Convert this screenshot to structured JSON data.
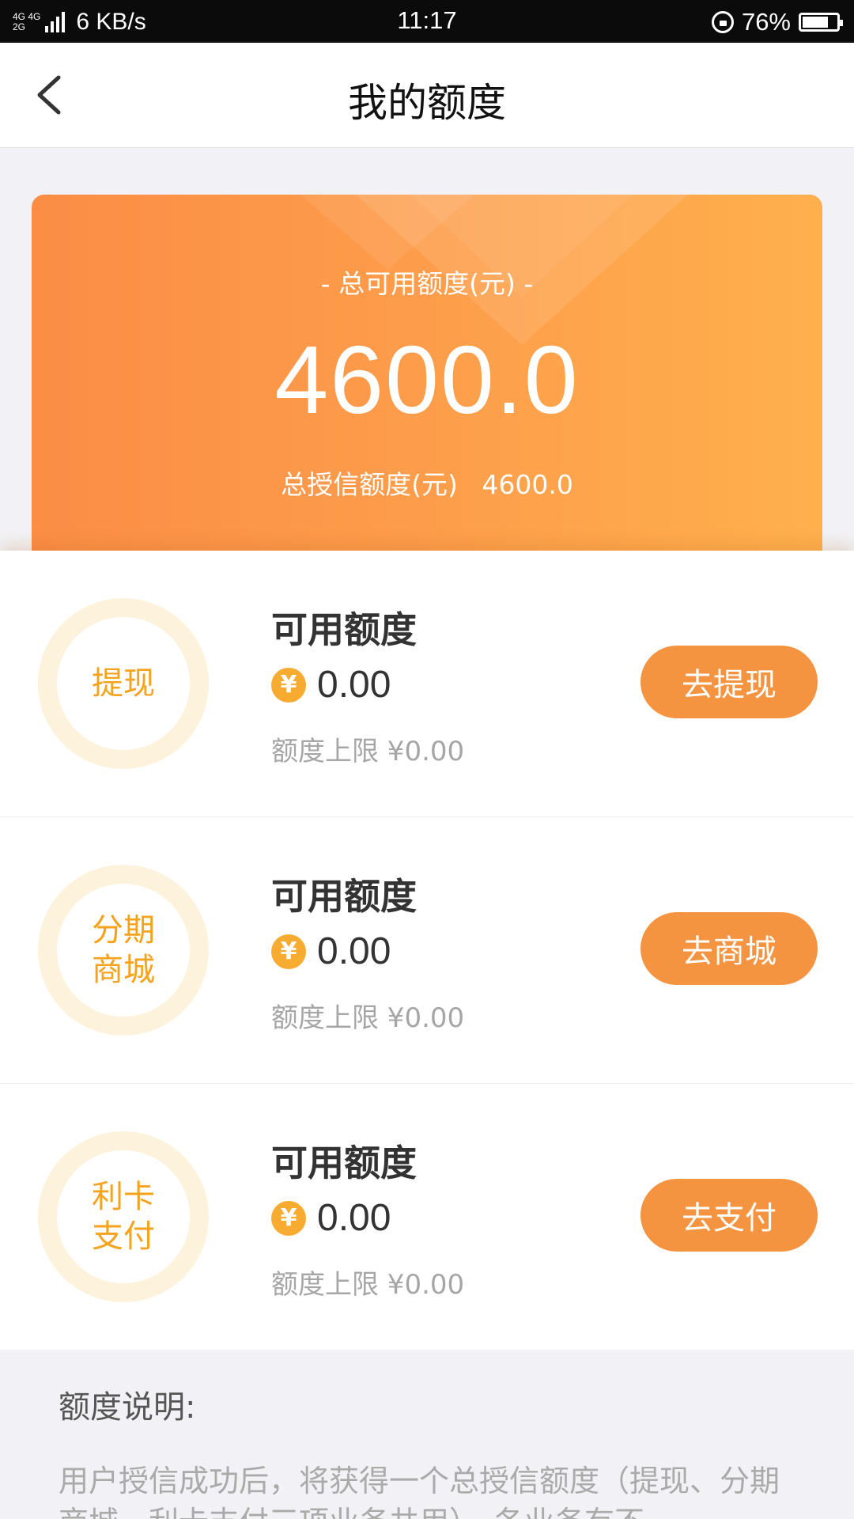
{
  "status_bar": {
    "network_top": "4G 4G",
    "network_bottom": "2G",
    "speed": "6 KB/s",
    "time": "11:17",
    "battery": "76%"
  },
  "nav": {
    "title": "我的额度",
    "back_icon": "chevron-left-icon"
  },
  "hero": {
    "subtitle": "- 总可用额度(元) -",
    "amount": "4600.0",
    "total_label": "总授信额度(元)",
    "total_value": "4600.0",
    "colors": {
      "from": "#fb8d45",
      "to": "#ffb04d"
    }
  },
  "credit_items": [
    {
      "ring_label": "提现",
      "title": "可用额度",
      "currency_icon": "¥",
      "amount": "0.00",
      "limit": "额度上限 ¥0.00",
      "button": "去提现"
    },
    {
      "ring_label": "分期商城",
      "title": "可用额度",
      "currency_icon": "¥",
      "amount": "0.00",
      "limit": "额度上限 ¥0.00",
      "button": "去商城"
    },
    {
      "ring_label": "利卡支付",
      "title": "可用额度",
      "currency_icon": "¥",
      "amount": "0.00",
      "limit": "额度上限 ¥0.00",
      "button": "去支付"
    }
  ],
  "notes": {
    "title": "额度说明:",
    "body": "用户授信成功后，将获得一个总授信额度（提现、分期商城、利卡支付三项业务共用），各业务有不"
  },
  "colors": {
    "accent": "#f59440",
    "ring": "#fdf3dc",
    "ring_text": "#f5a21c",
    "coin": "#f7ac31"
  }
}
